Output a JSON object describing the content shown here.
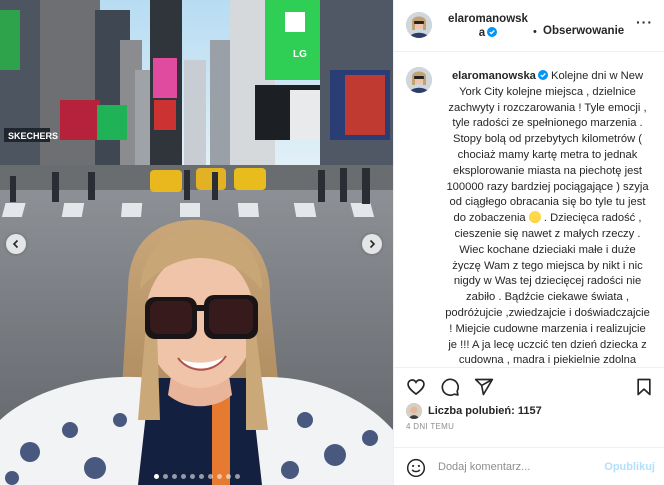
{
  "header": {
    "username": "elaromanowska",
    "separator": "•",
    "follow_label": "Obserwowanie",
    "more_label": "···"
  },
  "caption": {
    "username": "elaromanowska",
    "text_part1": "Kolejne dni w New York City kolejne miejsca , dzielnice zachwyty i rozczarowania ! Tyle emocji , tyle radości ze spełnionego marzenia . Stopy bolą od przebytych kilometrów ( chociaż mamy kartę metra to jednak eksplorowanie miasta na piechotę jest 100000 razy bardziej pociągające ) szyja od ciągłego obracania się bo tyle tu jest do zobaczenia",
    "text_part2": ". Dziecięca radość , cieszenie się nawet z małych rzeczy . Wiec kochane dzieciaki małe i duże życzę Wam z tego miejsca by nikt i nic nigdy w Was tej dziecięcej radości nie zabiło . Bądźcie ciekawe świata , podróżujcie ,zwiedzajcie i doświadczajcie ! Miejcie cudowne marzenia i realizujcie je !!! A ja lecę uczcić ten dzień dziecka z cudowna , madra i piekielnie zdolna"
  },
  "likes": {
    "label": "Liczba polubień: 1157"
  },
  "date": "4 DNI TEMU",
  "comment_box": {
    "placeholder": "Dodaj komentarz...",
    "post_label": "Opublikuj"
  },
  "billboards": {
    "skechers": "SKECHERS",
    "lg": "LG"
  },
  "carousel": {
    "slides": 10,
    "active_index": 0
  },
  "icons": {
    "verified": "verified-badge-icon",
    "like": "heart-icon",
    "comment": "comment-icon",
    "share": "share-icon",
    "save": "bookmark-icon",
    "emoji": "smiley-icon",
    "prev": "chevron-left-icon",
    "next": "chevron-right-icon"
  },
  "colors": {
    "verified": "#0095f6",
    "post_button": "#b2dffc",
    "muted_text": "#8e8e8e"
  }
}
